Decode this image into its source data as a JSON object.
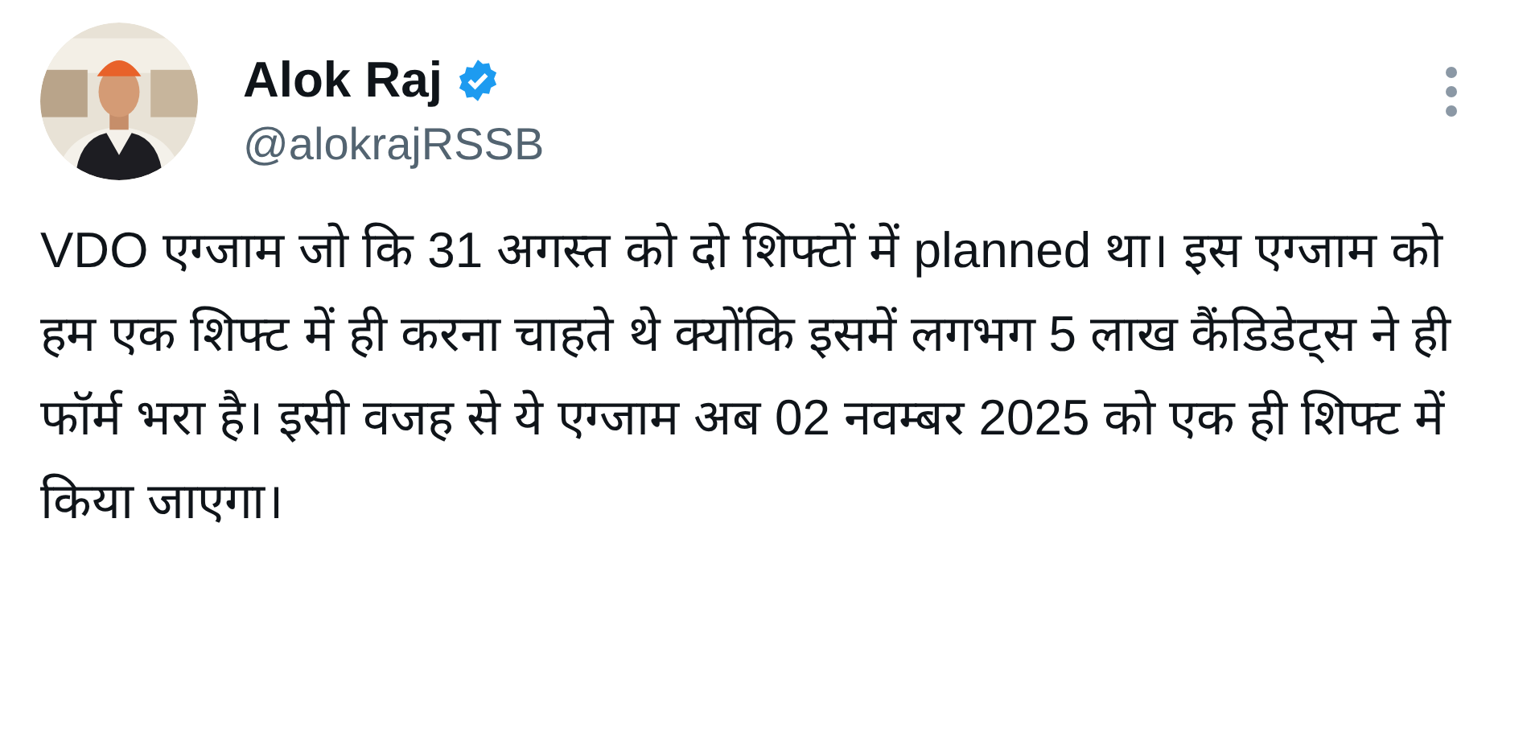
{
  "author": {
    "name": "Alok Raj",
    "verified": true,
    "handle": "@alokrajRSSB"
  },
  "tweet": {
    "text": "VDO एग्जाम जो कि 31 अगस्त को दो शिफ्टों में planned था। इस एग्जाम को हम एक शिफ्ट में ही करना चाहते थे क्योंकि इसमें लगभग 5 लाख कैंडिडेट्स ने ही फॉर्म भरा है। इसी वजह से ये एग्जाम अब 02 नवम्बर 2025 को एक ही शिफ्ट में किया जाएगा।"
  }
}
